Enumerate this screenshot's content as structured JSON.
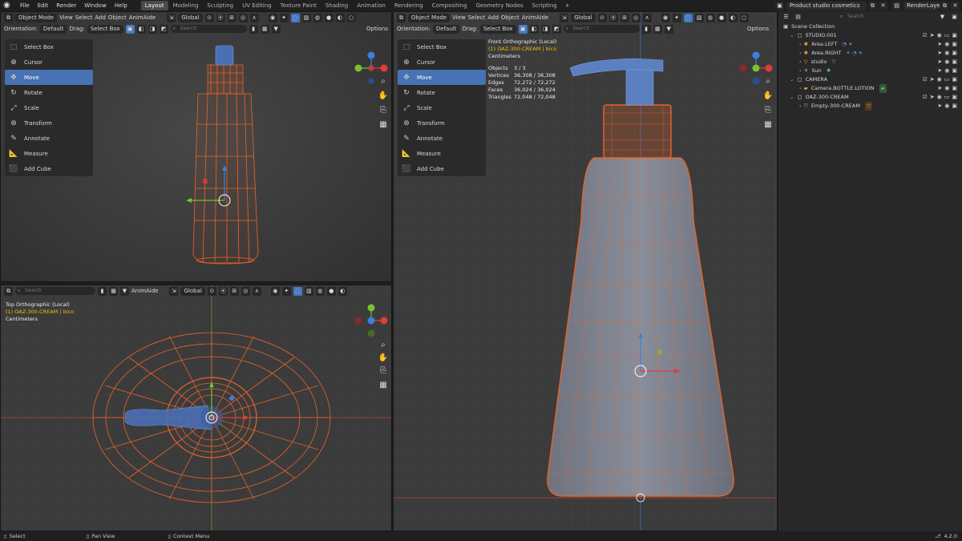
{
  "app": {
    "menu": [
      "File",
      "Edit",
      "Render",
      "Window",
      "Help"
    ],
    "workspaces": [
      "Layout",
      "Modeling",
      "Sculpting",
      "UV Editing",
      "Texture Paint",
      "Shading",
      "Animation",
      "Rendering",
      "Compositing",
      "Geometry Nodes",
      "Scripting"
    ],
    "active_workspace": "Layout",
    "scene": "Product studio cosmetics",
    "view_layer": "RenderLayer"
  },
  "viewport_header": {
    "mode": "Object Mode",
    "menus": [
      "View",
      "Select",
      "Add",
      "Object",
      "AnimAide"
    ],
    "transform": "Global",
    "orientation_label": "Orientation:",
    "orientation": "Default",
    "drag_label": "Drag:",
    "drag": "Select Box",
    "search_placeholder": "Search",
    "options": "Options"
  },
  "tools": [
    "Select Box",
    "Cursor",
    "Move",
    "Rotate",
    "Scale",
    "Transform",
    "Annotate",
    "Measure",
    "Add Cube"
  ],
  "active_tool": "Move",
  "front_view": {
    "title": "Front Orthographic (Local)",
    "object": "(1) OAZ-300-CREAM | bico",
    "units": "Centimeters",
    "stats": [
      {
        "label": "Objects",
        "value": "3 / 3"
      },
      {
        "label": "Vertices",
        "value": "36,308 / 36,308"
      },
      {
        "label": "Edges",
        "value": "72,272 / 72,272"
      },
      {
        "label": "Faces",
        "value": "36,024 / 36,024"
      },
      {
        "label": "Triangles",
        "value": "72,048 / 72,048"
      }
    ]
  },
  "top_view": {
    "title": "Top Orthographic (Local)",
    "object": "(1) OAZ-300-CREAM | bico",
    "units": "Centimeters",
    "search_placeholder": "Search",
    "addon": "AnimAide",
    "transform": "Global"
  },
  "gizmo_axes": {
    "x": "X",
    "y": "Y",
    "z": "Z"
  },
  "outliner": {
    "search_placeholder": "Search",
    "root": "Scene Collection",
    "rows": [
      {
        "name": "STUDIO.001",
        "level": 1,
        "type": "collection"
      },
      {
        "name": "Area.LEFT",
        "level": 2,
        "type": "light"
      },
      {
        "name": "Area.RIGHT",
        "level": 2,
        "type": "light"
      },
      {
        "name": "studio",
        "level": 2,
        "type": "mesh"
      },
      {
        "name": "Sun",
        "level": 2,
        "type": "light"
      },
      {
        "name": "CAMERA",
        "level": 1,
        "type": "collection"
      },
      {
        "name": "Camera.BOTTLE.LOTION",
        "level": 2,
        "type": "camera"
      },
      {
        "name": "OAZ-300-CREAM",
        "level": 1,
        "type": "collection"
      },
      {
        "name": "Empty-300-CREAM",
        "level": 2,
        "type": "empty"
      }
    ]
  },
  "statusbar": {
    "select": "Select",
    "pan": "Pan View",
    "context": "Context Menu",
    "version": "4.2.0"
  },
  "colors": {
    "selection": "#e8642a",
    "active_tool": "#4772b3",
    "x_axis": "#e03c3c",
    "y_axis": "#7cc033",
    "z_axis": "#3d7fe0"
  }
}
